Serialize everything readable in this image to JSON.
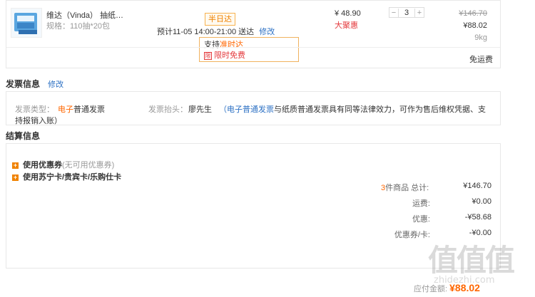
{
  "product": {
    "name": "维达（Vinda） 抽纸…",
    "spec": "规格：110抽*20包",
    "delivery_badge": "半日达",
    "delivery_text": "预计11-05 14:00-21:00 送达",
    "modify_link": "修改",
    "unit_price": "¥ 48.90",
    "promo_tag": "大聚惠",
    "quantity": "3",
    "minus": "−",
    "plus": "+",
    "original_total": "¥146.70",
    "subtotal": "¥88.02",
    "weight": "9kg",
    "tooltip_line1_prefix": "支持",
    "tooltip_line1_highlight": "准时达",
    "tooltip_line2": "限时免费",
    "tooltip_icon": "限",
    "free_shipping": "免运费"
  },
  "invoice": {
    "title": "发票信息",
    "modify_link": "修改",
    "type_label": "发票类型：",
    "type_value_highlight": "电子",
    "type_value_rest": "普通发票",
    "header_label": "发票抬头：",
    "header_value": "廖先生",
    "note_prefix": "（",
    "note_link": "电子普通发票",
    "note_rest": "与纸质普通发票具有同等法律效力，可作为售后维权凭据、支",
    "note_line2": "持报销入账）"
  },
  "settlement": {
    "title": "结算信息",
    "coupon_label": "使用优惠券",
    "coupon_note": "(无可用优惠券)",
    "card_label": "使用苏宁卡/贵宾卡/乐购仕卡",
    "count_num": "3",
    "count_text": "件商品 总计:",
    "total_value": "¥146.70",
    "freight_label": "运费:",
    "freight_value": "¥0.00",
    "discount_label": "优惠:",
    "discount_value": "-¥58.68",
    "coupon_card_label": "优惠券/卡:",
    "coupon_card_value": "-¥0.00",
    "payable_label": "应付金额:",
    "payable_value": "¥88.02"
  },
  "watermark": {
    "logo": "值值值",
    "domain": "zhidezhi.com"
  },
  "colors": {
    "accent": "#f60",
    "link": "#2d71c4",
    "badge_border": "#f7b24f"
  }
}
